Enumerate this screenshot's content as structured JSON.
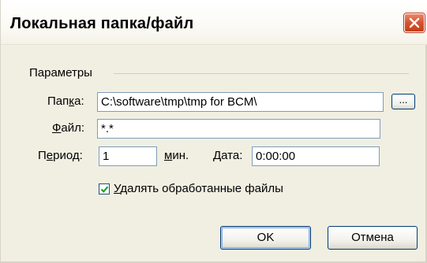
{
  "window": {
    "title": "Локальная папка/файл",
    "close_icon": "close-icon"
  },
  "params": {
    "section_label": "Параметры",
    "folder": {
      "label_pre": "Пап",
      "label_accel": "к",
      "label_post": "а:",
      "value": "C:\\software\\tmp\\tmp for BCM\\",
      "browse_label": "..."
    },
    "file": {
      "label_accel": "Ф",
      "label_post": "айл:",
      "value": "*.*"
    },
    "period": {
      "label_pre": "П",
      "label_accel": "е",
      "label_post": "риод:",
      "value": "1",
      "unit_accel": "м",
      "unit_post": "ин."
    },
    "date": {
      "label": "Дата:",
      "value": "0:00:00"
    },
    "delete_processed": {
      "checked": true,
      "label_accel": "У",
      "label_post": "далять обработанные файлы"
    }
  },
  "buttons": {
    "ok": "OK",
    "cancel": "Отмена"
  },
  "colors": {
    "dialog_bg": "#f1efe2",
    "close_button": "#d5532d",
    "field_border": "#7f9db9",
    "checkmark": "#21a121"
  }
}
